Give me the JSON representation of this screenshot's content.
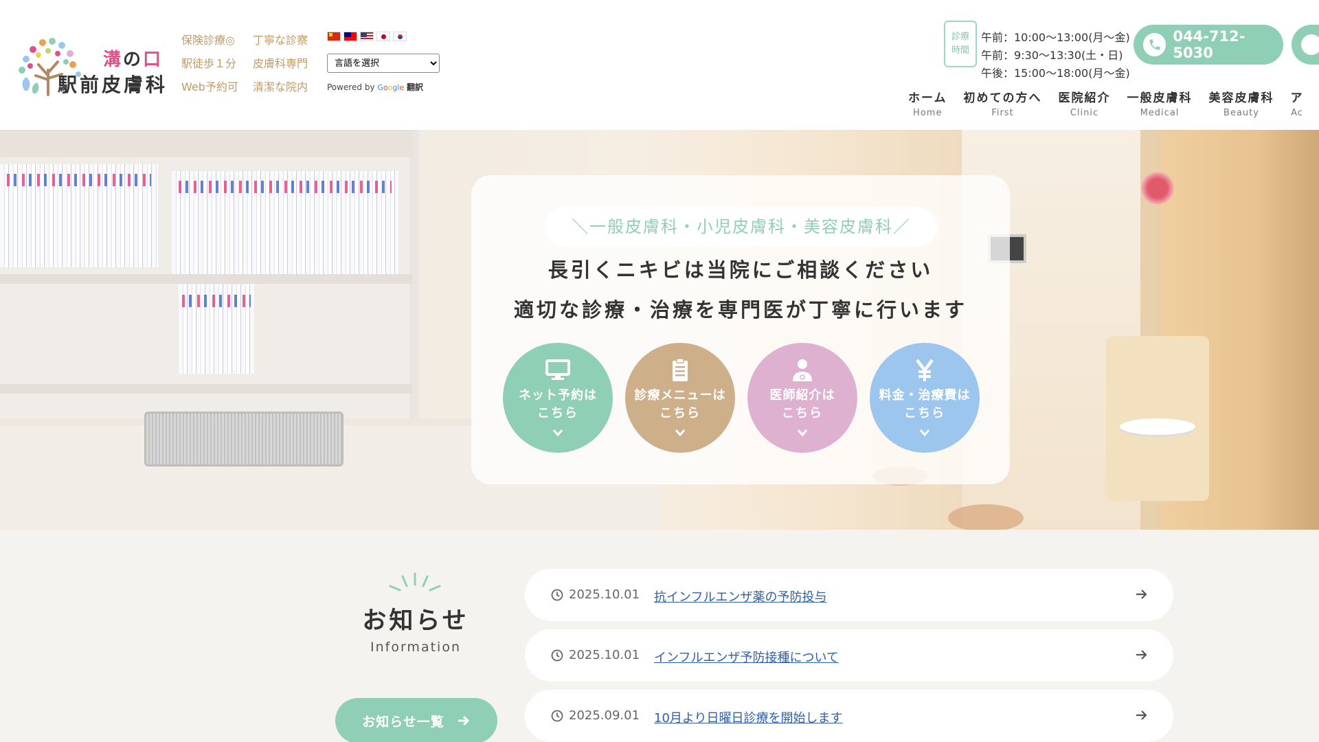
{
  "header": {
    "logo": {
      "line1_highlight_a": "溝",
      "line1_mid": "の",
      "line1_highlight_b": "口",
      "line2": "駅前皮膚科"
    },
    "features": [
      "保険診療◎",
      "丁寧な診察",
      "駅徒歩１分",
      "皮膚科専門",
      "Web予約可",
      "清潔な院内"
    ],
    "translate": {
      "select_label": "言語を選択",
      "powered_by": "Powered by",
      "google": "Google",
      "translate_label": "翻訳"
    },
    "hours": {
      "badge_l1": "診療",
      "badge_l2": "時間",
      "lines": [
        "午前：10:00〜13:00(月〜金)",
        "午前：9:30〜13:30(土・日)",
        "午後：15:00〜18:00(月〜金)"
      ]
    },
    "phone": "044-712-5030",
    "nav": [
      {
        "ja": "ホーム",
        "en": "Home"
      },
      {
        "ja": "初めての方へ",
        "en": "First"
      },
      {
        "ja": "医院紹介",
        "en": "Clinic"
      },
      {
        "ja": "一般皮膚科",
        "en": "Medical"
      },
      {
        "ja": "美容皮膚科",
        "en": "Beauty"
      },
      {
        "ja": "ア",
        "en": "Ac"
      }
    ]
  },
  "hero": {
    "tag": "＼一般皮膚科・小児皮膚科・美容皮膚科／",
    "line1": "長引くニキビは当院にご相談ください",
    "line2": "適切な診療・治療を専門医が丁寧に行います",
    "buttons": [
      {
        "l1": "ネット予約は",
        "l2": "こちら",
        "icon": "monitor-icon",
        "color": "#8fcfb5"
      },
      {
        "l1": "診療メニューは",
        "l2": "こちら",
        "icon": "clipboard-icon",
        "color": "#cdb08a"
      },
      {
        "l1": "医師紹介は",
        "l2": "こちら",
        "icon": "doctor-icon",
        "color": "#dfb1d1"
      },
      {
        "l1": "料金・治療費は",
        "l2": "こちら",
        "icon": "yen-icon",
        "color": "#9cc6ee"
      }
    ]
  },
  "news": {
    "title": "お知らせ",
    "subtitle": "Information",
    "all_button": "お知らせ一覧",
    "items": [
      {
        "date": "2025.10.01",
        "title": "抗インフルエンザ薬の予防投与"
      },
      {
        "date": "2025.10.01",
        "title": "インフルエンザ予防接種について"
      },
      {
        "date": "2025.09.01",
        "title": "10月より日曜日診療を開始します"
      }
    ]
  },
  "colors": {
    "accent_green": "#8fcfb5",
    "tan": "#cdb08a",
    "pink": "#dfb1d1",
    "blue": "#9cc6ee",
    "logo_pink": "#e0508a",
    "feature_text": "#c09a67",
    "link": "#2f5fa8"
  }
}
